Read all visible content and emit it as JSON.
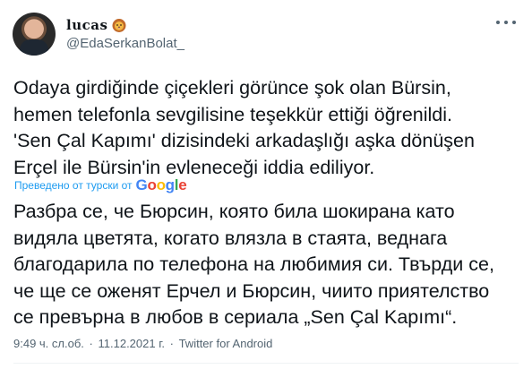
{
  "author": {
    "display_name": "lucas",
    "handle": "@EdaSerkanBolat_",
    "emoji_icon": "lion-face-icon"
  },
  "tweet": {
    "original_text": "Odaya girdiğinde çiçekleri görünce şok olan Bürsin,\nhemen telefonla sevgilisine teşekkür ettiği öğrenildi.\n'Sen Çal Kapımı' dizisindeki arkadaşlığı aşka dönüşen\nErçel ile Bürsin'in evleneceği iddia ediliyor.",
    "translated_by": "Преведено от турски от",
    "translator_logo_text": "Google",
    "translated_text": "Разбра се, че Бюрсин, която била шокирана като\nвидяла цветята, когато влязла в стаята, веднага\nблагодарила по телефона на любимия си. Твърди се,\nче ще се оженят Ерчел и Бюрсин, чиито приятелство\nсе превърна в любов в сериала „Sen Çal Kapımı“."
  },
  "meta": {
    "time": "9:49 ч. сл.об.",
    "separator": "·",
    "date": "11.12.2021 г.",
    "source": "Twitter for Android"
  },
  "colors": {
    "link_blue": "#1d9bf0",
    "secondary_text": "#536471",
    "primary_text": "#0f1419"
  },
  "icons": {
    "more": "more-options-icon",
    "avatar": "avatar"
  }
}
